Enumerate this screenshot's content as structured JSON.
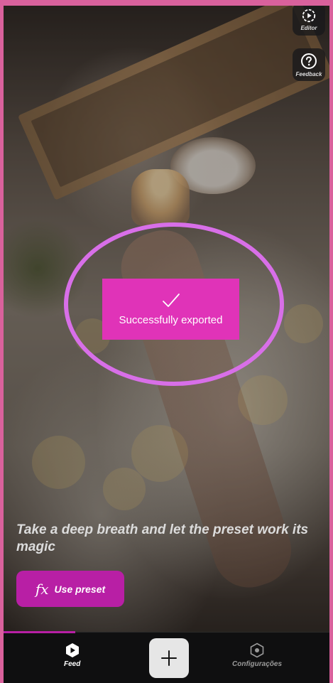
{
  "toolbar": {
    "editor_label": "Editor",
    "feedback_label": "Feedback"
  },
  "toast": {
    "message": "Successfully exported"
  },
  "preset": {
    "headline": "Take a deep breath and let the preset work its magic",
    "fx_symbol": "fx",
    "cta_label": "Use preset"
  },
  "bottom_nav": {
    "items": [
      {
        "label": "Feed",
        "icon": "play-icon",
        "active": true
      },
      {
        "label": "",
        "icon": "plus-icon"
      },
      {
        "label": "Configurações",
        "icon": "hexagon-settings-icon",
        "active": false
      }
    ],
    "progress_fraction": 0.22
  },
  "colors": {
    "accent": "#b81fa5",
    "toast": "#e033b8",
    "highlight_ring": "#d86fe8",
    "frame": "#d9619c"
  }
}
